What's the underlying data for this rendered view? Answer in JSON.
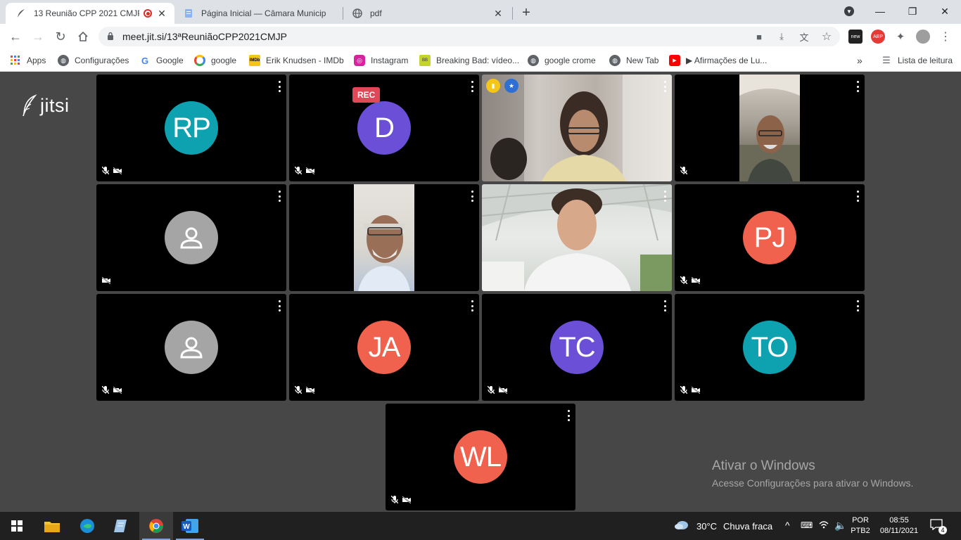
{
  "browser": {
    "tabs": [
      {
        "title": "13 Reunião CPP 2021 CMJP",
        "icon": "quill-icon",
        "recording": true
      },
      {
        "title": "Página Inicial — Câmara Municip",
        "icon": "page-icon"
      },
      {
        "title": "pdf",
        "icon": "globe-icon"
      }
    ],
    "new_tab_label": "+",
    "url": "meet.jit.si/13ªReuniãoCPP2021CMJP",
    "reading_list_label": "Lista de leitura"
  },
  "bookmarks": [
    {
      "label": "Apps",
      "icon": "apps-grid-icon"
    },
    {
      "label": "Configurações",
      "icon": "globe-icon"
    },
    {
      "label": "Google",
      "icon": "google-icon"
    },
    {
      "label": "google",
      "icon": "google-ring-icon"
    },
    {
      "label": "Erik Knudsen - IMDb",
      "icon": "imdb-icon"
    },
    {
      "label": "Instagram",
      "icon": "instagram-icon"
    },
    {
      "label": "Breaking Bad: vídeo...",
      "icon": "breaking-bad-icon"
    },
    {
      "label": "google crome",
      "icon": "globe-icon"
    },
    {
      "label": "New Tab",
      "icon": "globe-icon"
    },
    {
      "label": "▶ Afirmações de Lu...",
      "icon": "youtube-icon"
    }
  ],
  "app": {
    "logo_text": "jitsi",
    "rec_label": "REC"
  },
  "participants": [
    {
      "initials": "RP",
      "color": "#0ea2b1",
      "muted": true,
      "video_off": true
    },
    {
      "initials": "D",
      "color": "#6b4fd6",
      "muted": true,
      "video_off": true
    },
    {
      "initials": "",
      "video": true,
      "muted": false,
      "video_off": false
    },
    {
      "initials": "",
      "video": true,
      "muted": true,
      "video_off": false
    },
    {
      "initials": "",
      "generic_avatar": true,
      "muted": false,
      "video_off": true
    },
    {
      "initials": "",
      "video": true,
      "muted": false,
      "video_off": false
    },
    {
      "initials": "",
      "video": true,
      "muted": false,
      "video_off": false
    },
    {
      "initials": "PJ",
      "color": "#f0624d",
      "muted": true,
      "video_off": true
    },
    {
      "initials": "",
      "generic_avatar": true,
      "muted": true,
      "video_off": true
    },
    {
      "initials": "JA",
      "color": "#f0624d",
      "muted": true,
      "video_off": true
    },
    {
      "initials": "TC",
      "color": "#6b4fd6",
      "muted": true,
      "video_off": true
    },
    {
      "initials": "TO",
      "color": "#0ea2b1",
      "muted": true,
      "video_off": true
    },
    {
      "initials": "WL",
      "color": "#f0624d",
      "muted": true,
      "video_off": true
    }
  ],
  "watermark": {
    "title": "Ativar o Windows",
    "subtitle": "Acesse Configurações para ativar o Windows."
  },
  "taskbar": {
    "weather_temp": "30°C",
    "weather_text": "Chuva fraca",
    "lang_line1": "POR",
    "lang_line2": "PTB2",
    "time": "08:55",
    "date": "08/11/2021",
    "notification_count": "4"
  }
}
